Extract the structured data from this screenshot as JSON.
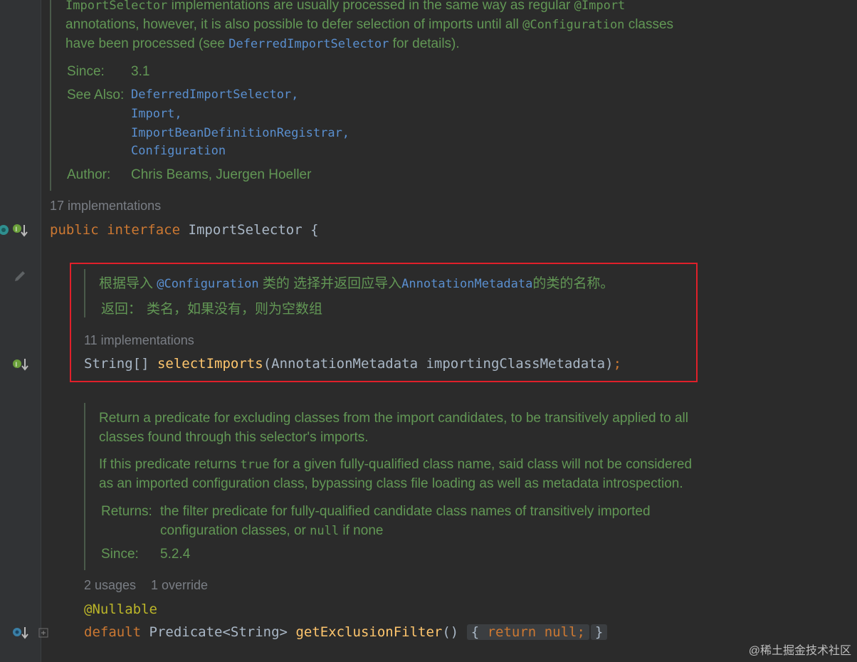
{
  "top_doc": {
    "line1_code": "ImportSelector",
    "line1_text": " implementations are usually processed in the same way as regular ",
    "line1_code2": "@Import",
    "line2_text": "annotations, however, it is also possible to defer selection of imports until all ",
    "line2_code": "@Configuration",
    "line2_text2": " classes",
    "line3_text": "have been processed (see ",
    "line3_code": "DeferredImportSelector",
    "line3_text2": " for details).",
    "since_label": "Since:",
    "since_value": "3.1",
    "see_also_label": "See Also:",
    "see_also": [
      "DeferredImportSelector,",
      "Import,",
      "ImportBeanDefinitionRegistrar,",
      "Configuration"
    ],
    "author_label": "Author:",
    "author_value": "Chris Beams, Juergen Hoeller"
  },
  "interface_hint": "17 implementations",
  "interface_decl": {
    "kw1": "public",
    "kw2": "interface",
    "name": "ImportSelector",
    "brace": "{"
  },
  "method1_doc": {
    "text1": "根据导入 ",
    "code1": "@Configuration",
    "text2": " 类的 选择并返回应导入",
    "code2": "AnnotationMetadata",
    "text3": "的类的名称。",
    "returns_label": "返回：",
    "returns_value": "类名，如果没有，则为空数组"
  },
  "method1_hint": "11 implementations",
  "method1_decl": {
    "type": "String[]",
    "name": "selectImports",
    "params": "(AnnotationMetadata importingClassMetadata)",
    "end": ";"
  },
  "method2_doc": {
    "p1_line1": "Return a predicate for excluding classes from the import candidates, to be transitively applied to all",
    "p1_line2": "classes found through this selector's imports.",
    "p2_line1a": "If this predicate returns ",
    "p2_line1_code": "true",
    "p2_line1b": " for a given fully-qualified class name, said class will not be considered",
    "p2_line2": "as an imported configuration class, bypassing class file loading as well as metadata introspection.",
    "returns_label": "Returns:",
    "returns_line1": "the filter predicate for fully-qualified candidate class names of transitively imported",
    "returns_line2a": "configuration classes, or ",
    "returns_line2_code": "null",
    "returns_line2b": " if none",
    "since_label": "Since:",
    "since_value": "5.2.4"
  },
  "method2_hints": {
    "usages": "2 usages",
    "override": "1 override"
  },
  "method2_annotation": "@Nullable",
  "method2_decl": {
    "kw": "default",
    "type": "Predicate<String>",
    "name": "getExclusionFilter",
    "parens": "()",
    "open": "{",
    "ret": "return",
    "null": "null;",
    "close": "}"
  },
  "watermark": "@稀土掘金技术社区",
  "colors": {
    "doc": "#629755",
    "keyword": "#cc7832",
    "function": "#ffc66d",
    "link": "#5a8fcf",
    "highlight_box": "#e0202a"
  }
}
